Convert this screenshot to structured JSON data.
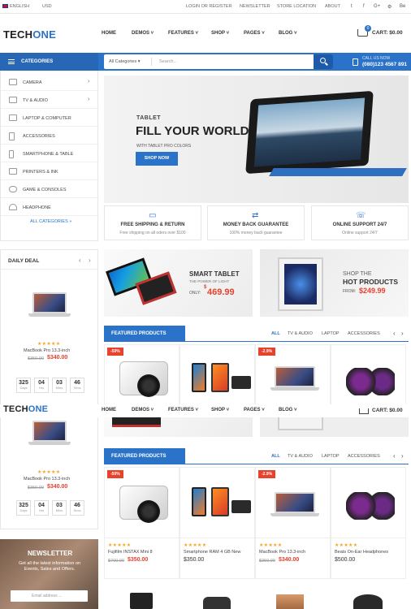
{
  "topbar": {
    "language": "ENGLISH",
    "currency": "USD",
    "links": [
      "LOGIN OR REGISTER",
      "NEWSLETTER",
      "STORE LOCATION",
      "ABOUT"
    ],
    "social": [
      "t",
      "f",
      "G+",
      "⚙",
      "Be"
    ]
  },
  "header": {
    "logo_a": "TECH",
    "logo_b": "ONE",
    "nav": [
      "HOME",
      "DEMOS",
      "FEATURES",
      "SHOP",
      "PAGES",
      "BLOG"
    ],
    "cart_count": "0",
    "cart_label": "CART: $0.00"
  },
  "catbar": {
    "categories_label": "CATEGORIES",
    "all_categories": "All Categories",
    "search_placeholder": "Search...",
    "call_label": "CALL US NOW",
    "phone": "(080)123 4567 891"
  },
  "sidebar": {
    "items": [
      "CAMERA",
      "TV & AUDIO",
      "LAPTOP & COMPUTER",
      "ACCESSORIES",
      "SMARTPHONE & TABLE",
      "PRINTERS & INK",
      "GAME & CONSOLES",
      "HEADPHONE"
    ],
    "all": "ALL CATEGORIES »"
  },
  "hero": {
    "kicker": "TABLET",
    "headline": "FILL YOUR WORLD",
    "sub": "WITH TABLET PRO COLORS",
    "cta": "SHOP NOW"
  },
  "features": [
    {
      "title": "FREE SHIPPING & RETURN",
      "sub": "Free shipping on all oders over $100",
      "icon": "truck-icon"
    },
    {
      "title": "MONEY BACK GUARANTEE",
      "sub": "100% money back guarantee",
      "icon": "refresh-icon"
    },
    {
      "title": "ONLINE SUPPORT 24/7",
      "sub": "Online support 24/7",
      "icon": "support-icon"
    }
  ],
  "deal": {
    "title": "DAILY DEAL",
    "product": "MacBook Pro 13.3-inch",
    "old": "$350.00",
    "new": "$340.00",
    "countdown": [
      {
        "n": "325",
        "l": "Days"
      },
      {
        "n": "04",
        "l": "Hrs"
      },
      {
        "n": "03",
        "l": "Mins"
      },
      {
        "n": "46",
        "l": "Secs"
      }
    ]
  },
  "banners": {
    "smart_title": "SMART TABLET",
    "smart_sub": "THE POWER OF LIGHT",
    "smart_only": "ONLY:",
    "smart_price_sup": "$",
    "smart_price": "469.99",
    "shop_the": "SHOP THE",
    "hot": "HOT PRODUCTS",
    "from": "FROM:",
    "hot_price": "$249.99"
  },
  "featured": {
    "title": "FEATURED PRODUCTS",
    "tabs": [
      "ALL",
      "TV & AUDIO",
      "LAPTOP",
      "ACCESSORIES"
    ],
    "products": [
      {
        "badge": "-50%",
        "name": "Fujifilm INSTAX Mini 8",
        "old": "$700.00",
        "new": "$350.00",
        "price": ""
      },
      {
        "badge": "",
        "name": "Smartphone RAM 4 GB New",
        "old": "",
        "new": "",
        "price": "$350.00"
      },
      {
        "badge": "-2.9%",
        "name": "MacBook Pro 13.3-inch",
        "old": "$350.00",
        "new": "$340.00",
        "price": ""
      },
      {
        "badge": "",
        "name": "Beats On-Ear Headphones",
        "old": "",
        "new": "",
        "price": "$500.00"
      }
    ]
  },
  "newsletter": {
    "title": "NEWSLETTER",
    "text": "Get all the latest information on Events, Sales and Offers.",
    "placeholder": "Email address ..."
  }
}
